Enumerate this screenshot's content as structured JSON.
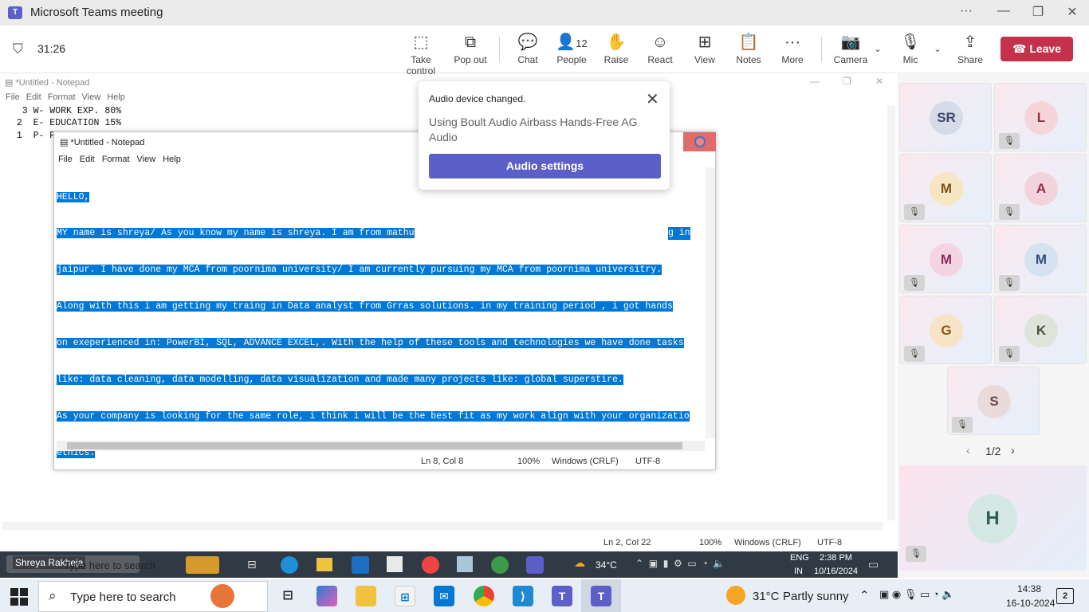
{
  "window": {
    "title": "Microsoft Teams meeting",
    "more": "···",
    "minimize": "—",
    "maximize": "❐",
    "close": "✕"
  },
  "meeting": {
    "timer": "31:26"
  },
  "toolbar": {
    "take_control": "Take control",
    "pop_out": "Pop out",
    "chat": "Chat",
    "people": "People",
    "people_count": "12",
    "raise": "Raise",
    "react": "React",
    "view": "View",
    "notes": "Notes",
    "more": "More",
    "camera": "Camera",
    "mic": "Mic",
    "share": "Share",
    "leave": "Leave"
  },
  "notepad_bg": {
    "title": "*Untitled - Notepad",
    "menu": [
      "File",
      "Edit",
      "Format",
      "View",
      "Help"
    ],
    "lines": [
      "  3 W- WORK EXP. 80%",
      " 2  E- EDUCATION 15%",
      " 1  P- P"
    ],
    "status": {
      "pos": "Ln 2, Col 22",
      "zoom": "100%",
      "eol": "Windows (CRLF)",
      "enc": "UTF-8"
    }
  },
  "notepad_fg": {
    "title": "*Untitled - Notepad",
    "menu": [
      "File",
      "Edit",
      "Format",
      "View",
      "Help"
    ],
    "lines": [
      "HELLO,",
      "MY name is shreya/ As you know my name is shreya. I am from mathu",
      "jaipur. I have done my MCA from poornima university/ I am currently pursuing my MCA from poornima universitry.",
      "Along with this i am getting my traing in Data analyst from Grras solutions. in my training period , i got hands",
      "on exeperienced in: PowerBI, SQL, ADVANCE EXCEL,. With the help of these tools and technologies we have done tasks",
      "like: data cleaning, data modelling, data visualization and made many projects like: global superstire.",
      "As your company is looking for the same role, i think i will be the best fit as my work align with your organizatio",
      "ethics."
    ],
    "line1_tail": "g in",
    "status": {
      "pos": "Ln 8, Col 8",
      "zoom": "100%",
      "eol": "Windows (CRLF)",
      "enc": "UTF-8"
    }
  },
  "popup": {
    "title": "Audio device changed.",
    "body": "Using Boult Audio Airbass Hands-Free AG Audio",
    "button": "Audio settings"
  },
  "participants": [
    {
      "initials": "SR",
      "muted": false,
      "color": "#d6dbe8",
      "text": "#3d4a6b"
    },
    {
      "initials": "L",
      "muted": true,
      "color": "#f4d6da",
      "text": "#8a3441"
    },
    {
      "initials": "M",
      "muted": true,
      "color": "#f7e6c4",
      "text": "#7a5418"
    },
    {
      "initials": "A",
      "muted": true,
      "color": "#f2d3dc",
      "text": "#8a2e4a"
    },
    {
      "initials": "M",
      "muted": true,
      "color": "#f4d3e2",
      "text": "#8a2f5a"
    },
    {
      "initials": "M",
      "muted": true,
      "color": "#d5e2f0",
      "text": "#2f4f7a"
    },
    {
      "initials": "G",
      "muted": true,
      "color": "#f7e3c6",
      "text": "#8a5a1a"
    },
    {
      "initials": "K",
      "muted": true,
      "color": "#dfe4da",
      "text": "#4a5240"
    },
    {
      "initials": "S",
      "muted": true,
      "color": "#eadad9",
      "text": "#6a4a48"
    }
  ],
  "pager": {
    "label": "1/2"
  },
  "featured": {
    "initials": "H",
    "muted": true
  },
  "inner_taskbar": {
    "name_tag": "Shreya Rakheja",
    "search": "Type here to search",
    "weather": "34°C",
    "lang1": "ENG",
    "lang2": "IN",
    "time": "2:38 PM",
    "date": "10/16/2024"
  },
  "taskbar": {
    "search": "Type here to search",
    "weather": "31°C",
    "weather_desc": "Partly sunny",
    "time": "14:38",
    "date": "16-10-2024",
    "notif_count": "2"
  }
}
